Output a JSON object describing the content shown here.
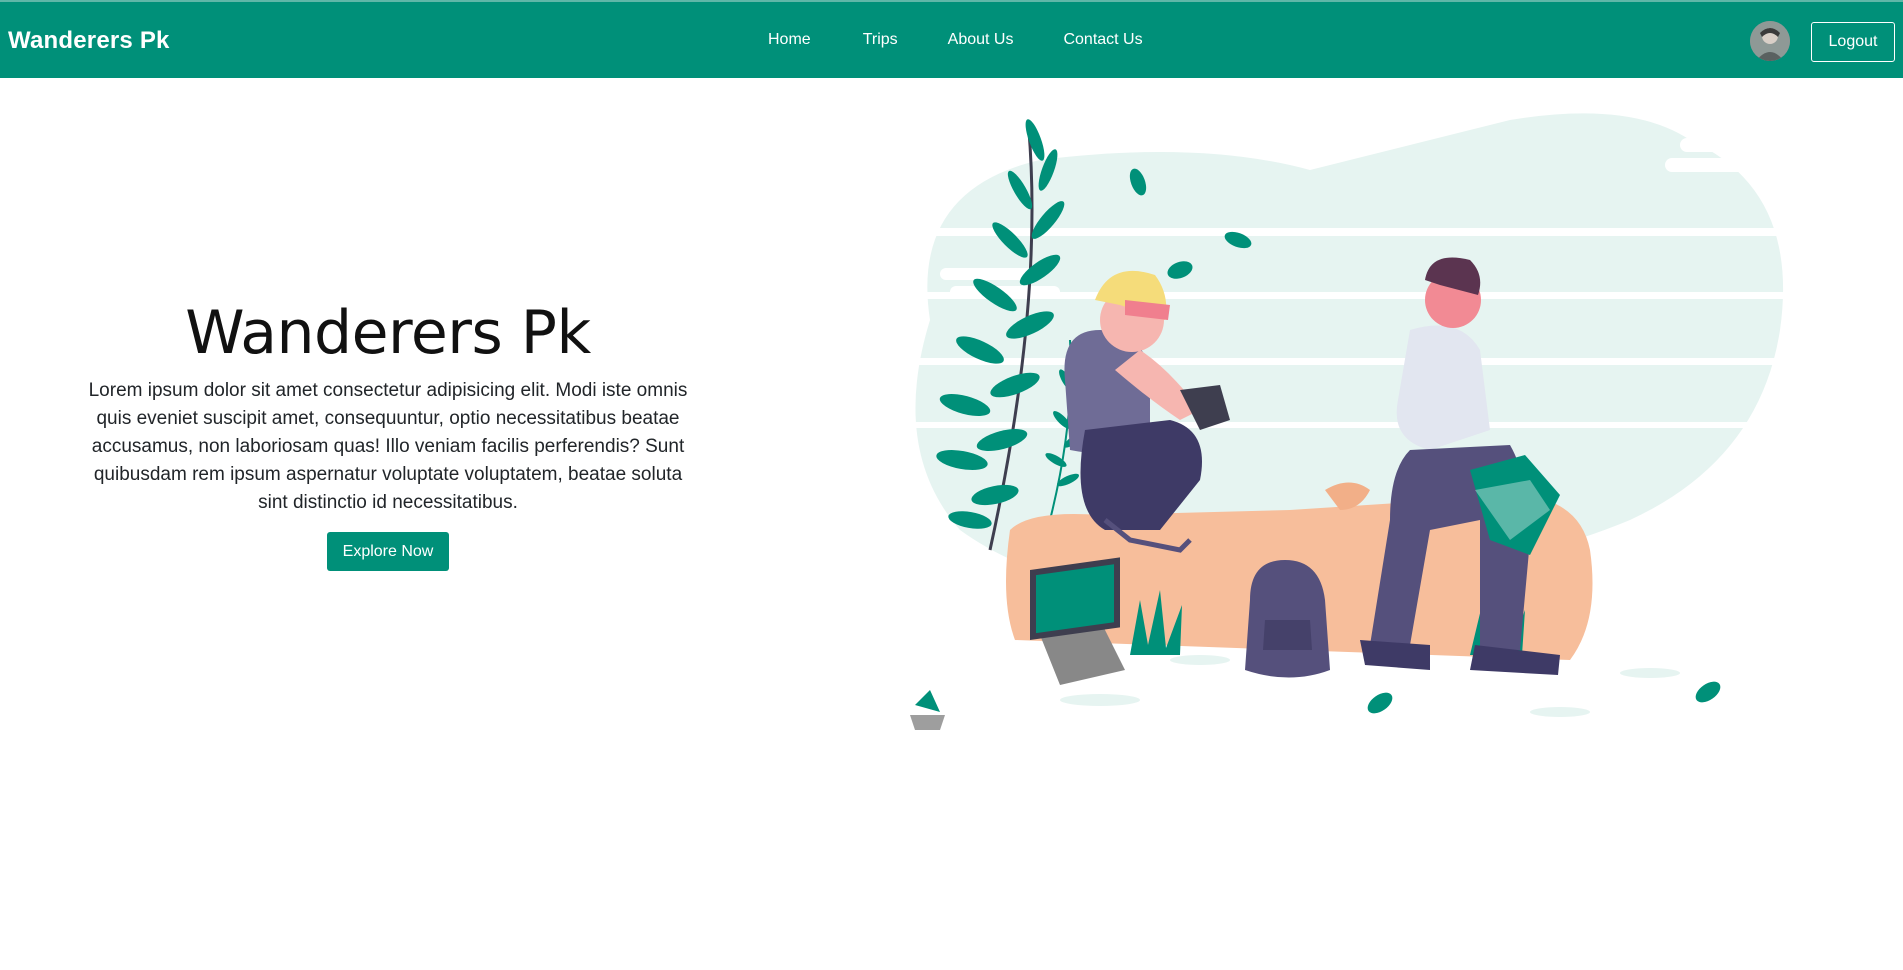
{
  "navbar": {
    "brand": "Wanderers Pk",
    "links": [
      {
        "label": "Home"
      },
      {
        "label": "Trips"
      },
      {
        "label": "About Us"
      },
      {
        "label": "Contact Us"
      }
    ],
    "logout_label": "Logout"
  },
  "hero": {
    "title": "Wanderers Pk",
    "text": "Lorem ipsum dolor sit amet consectetur adipisicing elit. Modi iste omnis quis eveniet suscipit amet, consequuntur, optio necessitatibus beatae accusamus, non laboriosam quas! Illo veniam facilis perferendis? Sunt quibusdam rem ipsum aspernatur voluptate voluptatem, beatae soluta sint distinctio id necessitatibus.",
    "button_label": "Explore Now"
  },
  "colors": {
    "brand": "#009079",
    "background": "#ffffff",
    "illustration_bg": "#e6f4f1"
  },
  "icons": [
    "avatar-photo",
    "travel-illustration"
  ]
}
